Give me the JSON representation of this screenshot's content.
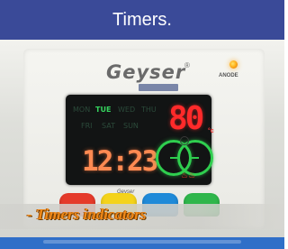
{
  "header": {
    "title": "Timers."
  },
  "device": {
    "brand": "Geyser",
    "brand_sub": "",
    "reg_mark": "®",
    "led_label": "ANODE",
    "days_row1": [
      "MON",
      "TUE",
      "WED",
      "THU"
    ],
    "days_row2": [
      "FRI",
      "SAT",
      "SUN"
    ],
    "active_day": "TUE",
    "temperature": "80",
    "temperature_unit": "°c",
    "clock": "12:23",
    "signature": "Geyser",
    "buttons": [
      {
        "name": "red-button",
        "color": "#e53a2a"
      },
      {
        "name": "yellow-button",
        "color": "#f4d31a"
      },
      {
        "name": "blue-button",
        "color": "#1f8ad8"
      },
      {
        "name": "green-button",
        "color": "#2fb64b"
      }
    ],
    "colors": {
      "led_red": "#ff2a2a",
      "led_orange": "#ff8a52",
      "led_green": "#2fcf4f"
    }
  },
  "caption": {
    "text": "- Timers indicators"
  }
}
